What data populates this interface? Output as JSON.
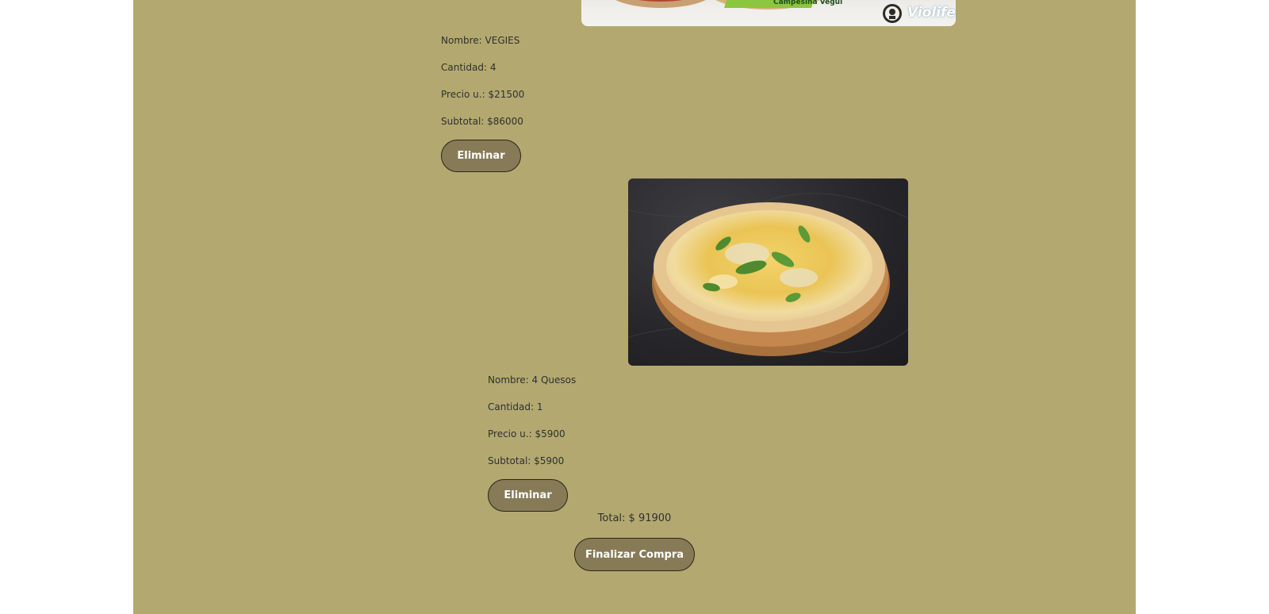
{
  "cart": {
    "items": [
      {
        "image_alt": "Campesina Vegui",
        "image_caption": "Campesina Vegui",
        "image_brand": "Violife",
        "nombre": "Nombre: VEGIES",
        "cantidad": "Cantidad: 4",
        "precio": "Precio u.: $21500",
        "subtotal": "Subtotal: $86000",
        "delete_label": "Eliminar"
      },
      {
        "image_alt": "4 Quesos",
        "nombre": "Nombre: 4 Quesos",
        "cantidad": "Cantidad: 1",
        "precio": "Precio u.: $5900",
        "subtotal": "Subtotal: $5900",
        "delete_label": "Eliminar"
      }
    ],
    "total": "Total: $ 91900",
    "checkout_label": "Finalizar Compra"
  },
  "colors": {
    "page_background": "#b3a970",
    "button_background": "#877b57",
    "button_text": "#ffffff",
    "outer_background": "#ffffff"
  }
}
